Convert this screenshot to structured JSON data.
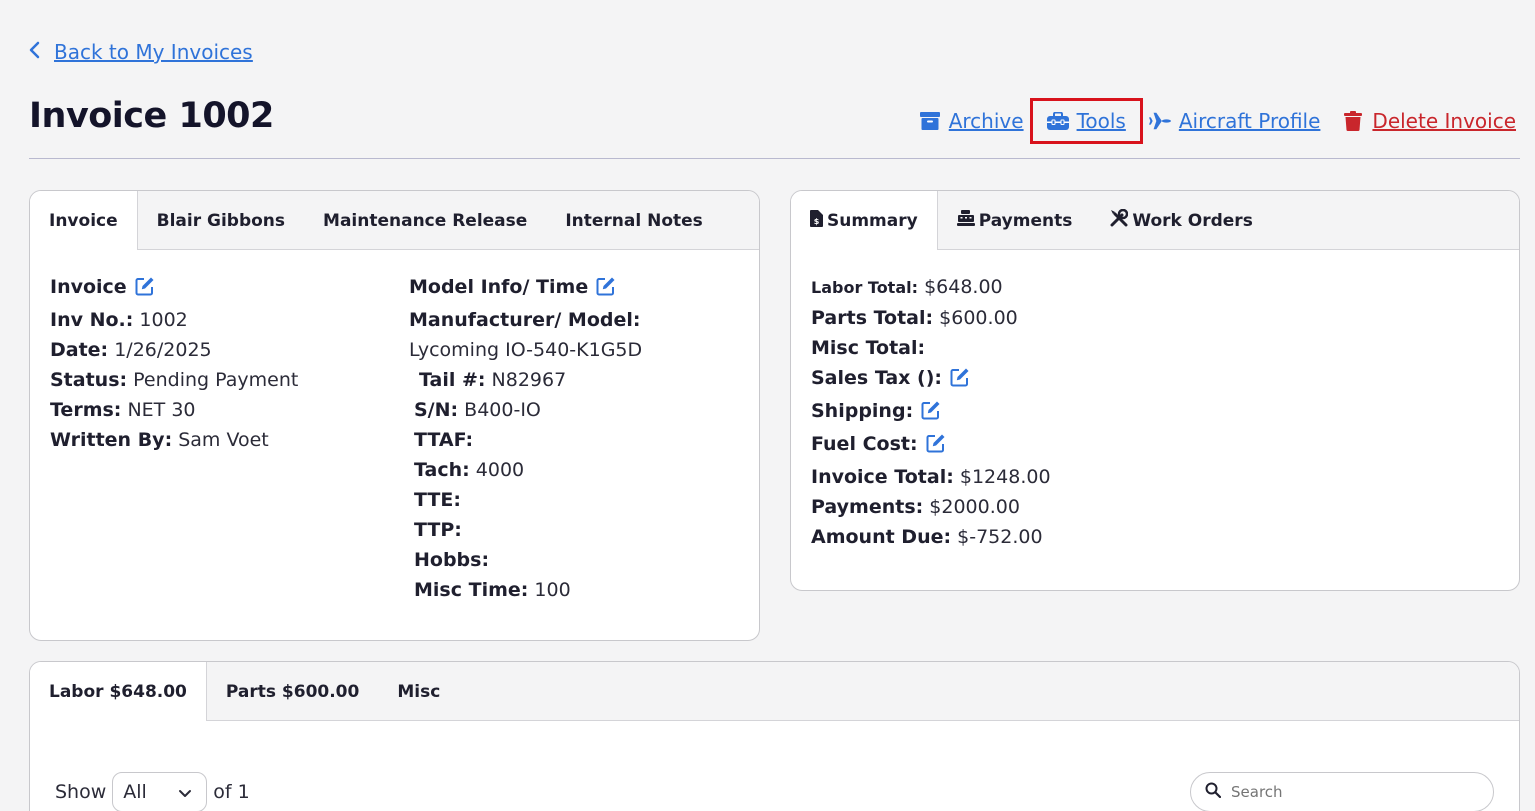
{
  "nav": {
    "back_label": "Back to My Invoices"
  },
  "header": {
    "title": "Invoice 1002",
    "actions": {
      "archive": "Archive",
      "tools": "Tools",
      "aircraft": "Aircraft Profile",
      "delete": "Delete Invoice"
    }
  },
  "colors": {
    "link": "#2f73d9",
    "danger": "#c9262c",
    "highlight": "#d8121c"
  },
  "left_card": {
    "tabs": [
      "Invoice",
      "Blair Gibbons",
      "Maintenance Release",
      "Internal Notes"
    ],
    "invoice": {
      "heading": "Invoice",
      "inv_no_label": "Inv No.:",
      "inv_no": "1002",
      "date_label": "Date:",
      "date": "1/26/2025",
      "status_label": "Status:",
      "status": "Pending Payment",
      "terms_label": "Terms:",
      "terms": "NET 30",
      "written_label": "Written By:",
      "written": "Sam Voet"
    },
    "model": {
      "heading": "Model Info/ Time",
      "manufacturer_label": "Manufacturer/ Model:",
      "manufacturer": "Lycoming IO-540-K1G5D",
      "tail_label": "Tail #:",
      "tail": "N82967",
      "sn_label": "S/N:",
      "sn": "B400-IO",
      "ttaf_label": "TTAF:",
      "ttaf": "",
      "tach_label": "Tach:",
      "tach": "4000",
      "tte_label": "TTE:",
      "tte": "",
      "ttp_label": "TTP:",
      "ttp": "",
      "hobbs_label": "Hobbs:",
      "hobbs": "",
      "misc_label": "Misc Time:",
      "misc": "100"
    }
  },
  "right_card": {
    "tabs": [
      "Summary",
      "Payments",
      "Work Orders"
    ],
    "summary": {
      "labor_label": "Labor Total:",
      "labor": "$648.00",
      "parts_label": "Parts Total:",
      "parts": "$600.00",
      "misc_label": "Misc Total:",
      "misc": "",
      "tax_label": "Sales Tax ():",
      "shipping_label": "Shipping:",
      "fuel_label": "Fuel Cost:",
      "invoice_total_label": "Invoice Total:",
      "invoice_total": "$1248.00",
      "payments_label": "Payments:",
      "payments": "$2000.00",
      "due_label": "Amount Due:",
      "due": "$-752.00"
    }
  },
  "bottom_card": {
    "tabs": [
      "Labor $648.00",
      "Parts $600.00",
      "Misc"
    ],
    "show_label": "Show",
    "show_value": "All",
    "of_label": "of 1",
    "search_placeholder": "Search"
  }
}
